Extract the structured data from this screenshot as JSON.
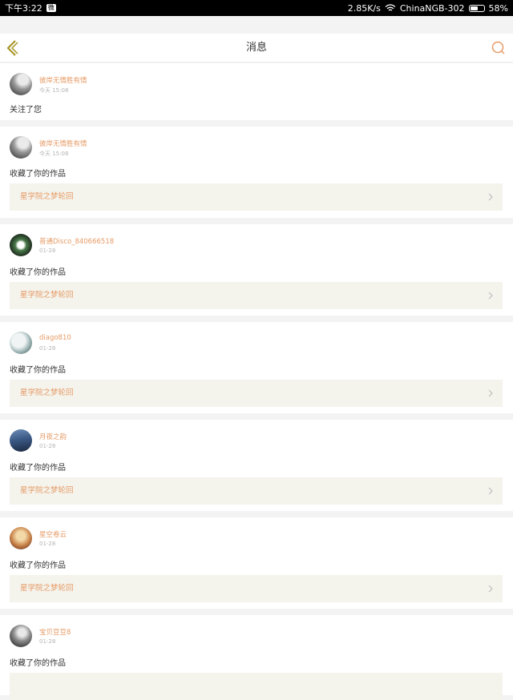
{
  "status_bar": {
    "time": "下午3:22",
    "app_icon_label": "微",
    "network_speed": "2.85K/s",
    "wifi_name": "ChinaNGB-302",
    "battery": "58%",
    "battery_level": 0.58
  },
  "header": {
    "title": "消息",
    "back_icon": "chevron-left-icon",
    "search_icon": "search-icon"
  },
  "colors": {
    "accent": "#e69b66",
    "back_icon": "#a89526",
    "work_box_bg": "#f4f3ec"
  },
  "messages": [
    {
      "username": "彼岸无情胜有情",
      "time": "今天 15:08",
      "action": "关注了您",
      "work_title": null
    },
    {
      "username": "彼岸无情胜有情",
      "time": "今天 15:08",
      "action": "收藏了你的作品",
      "work_title": "星学院之梦轮回"
    },
    {
      "username": "普通Disco_840666518",
      "time": "01-28",
      "action": "收藏了你的作品",
      "work_title": "星学院之梦轮回"
    },
    {
      "username": "diago810",
      "time": "01-28",
      "action": "收藏了你的作品",
      "work_title": "星学院之梦轮回"
    },
    {
      "username": "月夜之韵",
      "time": "01-28",
      "action": "收藏了你的作品",
      "work_title": "星学院之梦轮回"
    },
    {
      "username": "星空卷云",
      "time": "01-28",
      "action": "收藏了你的作品",
      "work_title": "星学院之梦轮回"
    },
    {
      "username": "宝贝豆豆8",
      "time": "01-28",
      "action": "收藏了你的作品",
      "work_title": ""
    }
  ]
}
